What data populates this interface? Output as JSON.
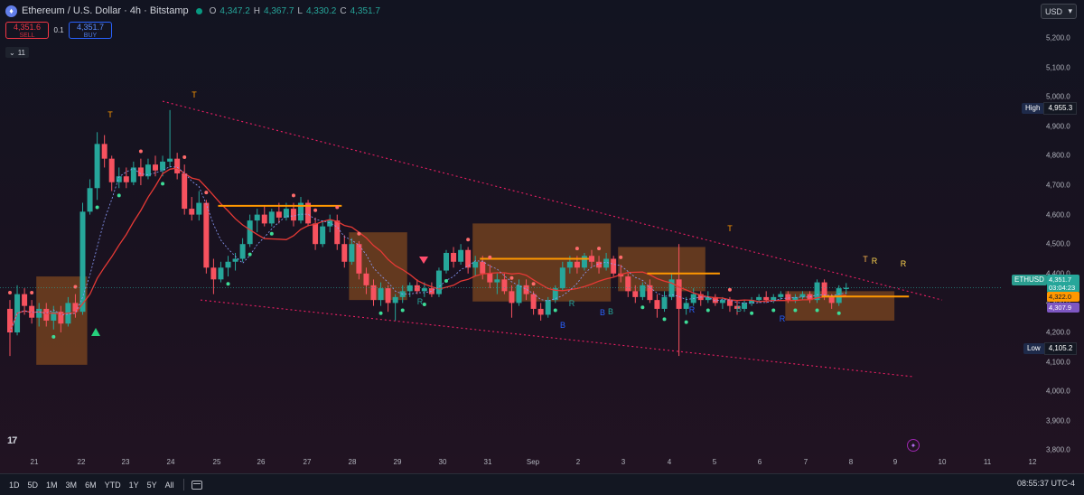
{
  "header": {
    "symbol_icon": "ethereum-icon",
    "title": "Ethereum / U.S. Dollar · 4h · Bitstamp",
    "status_color": "#089981",
    "ohlc": {
      "o_key": "O",
      "o": "4,347.2",
      "h_key": "H",
      "h": "4,367.7",
      "l_key": "L",
      "l": "4,330.2",
      "c_key": "C",
      "c": "4,351.7"
    }
  },
  "trade": {
    "sell_price": "4,351.6",
    "sell_label": "SELL",
    "qty": "0.1",
    "buy_price": "4,351.7",
    "buy_label": "BUY"
  },
  "indicators": {
    "count": "11"
  },
  "currency": {
    "label": "USD"
  },
  "price_axis": {
    "ticks": [
      "5,200.0",
      "5,100.0",
      "5,000.0",
      "4,900.0",
      "4,800.0",
      "4,700.0",
      "4,600.0",
      "4,500.0",
      "4,400.0",
      "4,300.0",
      "4,200.0",
      "4,100.0",
      "4,000.0",
      "3,900.0",
      "3,800.0"
    ],
    "high_label": "High",
    "high_value": "4,955.3",
    "low_label": "Low",
    "low_value": "4,105.2",
    "symbol_tag": "ETHUSD",
    "last_price": "4,351.7",
    "countdown": "03:04:23",
    "tag_orange": "4,322.0",
    "tag_purple": "4,307.9"
  },
  "time_axis": {
    "labels": [
      "21",
      "22",
      "23",
      "24",
      "25",
      "26",
      "27",
      "28",
      "29",
      "30",
      "31",
      "Sep",
      "2",
      "3",
      "4",
      "5",
      "6",
      "7",
      "8",
      "9",
      "10",
      "11",
      "12"
    ]
  },
  "ranges": [
    "1D",
    "5D",
    "1M",
    "3M",
    "6M",
    "YTD",
    "1Y",
    "5Y",
    "All"
  ],
  "clock": "08:55:37 UTC-4",
  "logo_text": "17",
  "chart_marks": [
    "T",
    "T",
    "T",
    "T",
    "R",
    "R",
    "R",
    "R",
    "R",
    "B",
    "B",
    "B",
    "B",
    "R",
    "R"
  ],
  "colors": {
    "up": "#26a69a",
    "down": "#f7525f",
    "zone": "#a0591f",
    "trend": "#e91e63",
    "ema_red": "#e53935",
    "ema_green": "#2e7d32",
    "orange": "#ff9800",
    "purple": "#7e57c2",
    "blue": "#2962ff"
  },
  "chart_data": {
    "type": "candlestick",
    "x_unit": "date (4h candles)",
    "y_range": [
      3760,
      5260
    ],
    "candles": [
      {
        "t": "Aug 20 20:00",
        "o": 4280,
        "h": 4310,
        "l": 4120,
        "c": 4200
      },
      {
        "t": "Aug 21 00:00",
        "o": 4200,
        "h": 4360,
        "l": 4190,
        "c": 4330
      },
      {
        "t": "Aug 21 04:00",
        "o": 4330,
        "h": 4350,
        "l": 4260,
        "c": 4290
      },
      {
        "t": "Aug 21 08:00",
        "o": 4290,
        "h": 4310,
        "l": 4230,
        "c": 4250
      },
      {
        "t": "Aug 21 12:00",
        "o": 4250,
        "h": 4300,
        "l": 4220,
        "c": 4280
      },
      {
        "t": "Aug 21 16:00",
        "o": 4280,
        "h": 4300,
        "l": 4220,
        "c": 4240
      },
      {
        "t": "Aug 21 20:00",
        "o": 4240,
        "h": 4290,
        "l": 4210,
        "c": 4270
      },
      {
        "t": "Aug 22 00:00",
        "o": 4270,
        "h": 4290,
        "l": 4200,
        "c": 4230
      },
      {
        "t": "Aug 22 04:00",
        "o": 4230,
        "h": 4320,
        "l": 4220,
        "c": 4300
      },
      {
        "t": "Aug 22 08:00",
        "o": 4300,
        "h": 4330,
        "l": 4250,
        "c": 4270
      },
      {
        "t": "Aug 22 12:00",
        "o": 4270,
        "h": 4640,
        "l": 4260,
        "c": 4610
      },
      {
        "t": "Aug 22 16:00",
        "o": 4610,
        "h": 4720,
        "l": 4600,
        "c": 4690
      },
      {
        "t": "Aug 22 20:00",
        "o": 4690,
        "h": 4880,
        "l": 4650,
        "c": 4840
      },
      {
        "t": "Aug 23 00:00",
        "o": 4840,
        "h": 4870,
        "l": 4760,
        "c": 4790
      },
      {
        "t": "Aug 23 04:00",
        "o": 4790,
        "h": 4800,
        "l": 4680,
        "c": 4710
      },
      {
        "t": "Aug 23 08:00",
        "o": 4710,
        "h": 4760,
        "l": 4690,
        "c": 4730
      },
      {
        "t": "Aug 23 12:00",
        "o": 4730,
        "h": 4760,
        "l": 4690,
        "c": 4710
      },
      {
        "t": "Aug 23 16:00",
        "o": 4710,
        "h": 4780,
        "l": 4700,
        "c": 4760
      },
      {
        "t": "Aug 23 20:00",
        "o": 4760,
        "h": 4790,
        "l": 4700,
        "c": 4730
      },
      {
        "t": "Aug 24 00:00",
        "o": 4730,
        "h": 4790,
        "l": 4720,
        "c": 4770
      },
      {
        "t": "Aug 24 04:00",
        "o": 4770,
        "h": 4800,
        "l": 4730,
        "c": 4750
      },
      {
        "t": "Aug 24 08:00",
        "o": 4750,
        "h": 4800,
        "l": 4730,
        "c": 4780
      },
      {
        "t": "Aug 24 12:00",
        "o": 4780,
        "h": 4955,
        "l": 4760,
        "c": 4790
      },
      {
        "t": "Aug 24 16:00",
        "o": 4790,
        "h": 4810,
        "l": 4720,
        "c": 4740
      },
      {
        "t": "Aug 24 20:00",
        "o": 4740,
        "h": 4770,
        "l": 4600,
        "c": 4620
      },
      {
        "t": "Aug 25 00:00",
        "o": 4620,
        "h": 4660,
        "l": 4580,
        "c": 4600
      },
      {
        "t": "Aug 25 04:00",
        "o": 4600,
        "h": 4680,
        "l": 4580,
        "c": 4640
      },
      {
        "t": "Aug 25 08:00",
        "o": 4640,
        "h": 4650,
        "l": 4400,
        "c": 4420
      },
      {
        "t": "Aug 25 12:00",
        "o": 4420,
        "h": 4450,
        "l": 4330,
        "c": 4380
      },
      {
        "t": "Aug 25 16:00",
        "o": 4380,
        "h": 4440,
        "l": 4370,
        "c": 4420
      },
      {
        "t": "Aug 25 20:00",
        "o": 4420,
        "h": 4460,
        "l": 4390,
        "c": 4440
      },
      {
        "t": "Aug 26 00:00",
        "o": 4440,
        "h": 4470,
        "l": 4410,
        "c": 4450
      },
      {
        "t": "Aug 26 04:00",
        "o": 4450,
        "h": 4520,
        "l": 4440,
        "c": 4500
      },
      {
        "t": "Aug 26 08:00",
        "o": 4500,
        "h": 4600,
        "l": 4490,
        "c": 4580
      },
      {
        "t": "Aug 26 12:00",
        "o": 4580,
        "h": 4620,
        "l": 4540,
        "c": 4600
      },
      {
        "t": "Aug 26 16:00",
        "o": 4600,
        "h": 4630,
        "l": 4560,
        "c": 4570
      },
      {
        "t": "Aug 26 20:00",
        "o": 4570,
        "h": 4620,
        "l": 4560,
        "c": 4610
      },
      {
        "t": "Aug 27 00:00",
        "o": 4610,
        "h": 4640,
        "l": 4570,
        "c": 4590
      },
      {
        "t": "Aug 27 04:00",
        "o": 4590,
        "h": 4640,
        "l": 4580,
        "c": 4620
      },
      {
        "t": "Aug 27 08:00",
        "o": 4620,
        "h": 4640,
        "l": 4560,
        "c": 4580
      },
      {
        "t": "Aug 27 12:00",
        "o": 4580,
        "h": 4660,
        "l": 4570,
        "c": 4640
      },
      {
        "t": "Aug 27 16:00",
        "o": 4640,
        "h": 4650,
        "l": 4560,
        "c": 4570
      },
      {
        "t": "Aug 27 20:00",
        "o": 4570,
        "h": 4590,
        "l": 4480,
        "c": 4500
      },
      {
        "t": "Aug 28 00:00",
        "o": 4500,
        "h": 4580,
        "l": 4490,
        "c": 4560
      },
      {
        "t": "Aug 28 04:00",
        "o": 4560,
        "h": 4600,
        "l": 4540,
        "c": 4580
      },
      {
        "t": "Aug 28 08:00",
        "o": 4580,
        "h": 4600,
        "l": 4480,
        "c": 4500
      },
      {
        "t": "Aug 28 12:00",
        "o": 4500,
        "h": 4530,
        "l": 4420,
        "c": 4440
      },
      {
        "t": "Aug 28 16:00",
        "o": 4440,
        "h": 4520,
        "l": 4430,
        "c": 4500
      },
      {
        "t": "Aug 28 20:00",
        "o": 4500,
        "h": 4510,
        "l": 4380,
        "c": 4400
      },
      {
        "t": "Aug 29 00:00",
        "o": 4400,
        "h": 4420,
        "l": 4330,
        "c": 4360
      },
      {
        "t": "Aug 29 04:00",
        "o": 4360,
        "h": 4380,
        "l": 4290,
        "c": 4310
      },
      {
        "t": "Aug 29 08:00",
        "o": 4310,
        "h": 4370,
        "l": 4290,
        "c": 4350
      },
      {
        "t": "Aug 29 12:00",
        "o": 4350,
        "h": 4360,
        "l": 4270,
        "c": 4300
      },
      {
        "t": "Aug 29 16:00",
        "o": 4300,
        "h": 4330,
        "l": 4240,
        "c": 4320
      },
      {
        "t": "Aug 29 20:00",
        "o": 4320,
        "h": 4360,
        "l": 4300,
        "c": 4340
      },
      {
        "t": "Aug 30 00:00",
        "o": 4340,
        "h": 4370,
        "l": 4320,
        "c": 4360
      },
      {
        "t": "Aug 30 04:00",
        "o": 4360,
        "h": 4380,
        "l": 4330,
        "c": 4340
      },
      {
        "t": "Aug 30 08:00",
        "o": 4340,
        "h": 4370,
        "l": 4320,
        "c": 4350
      },
      {
        "t": "Aug 30 12:00",
        "o": 4350,
        "h": 4370,
        "l": 4320,
        "c": 4330
      },
      {
        "t": "Aug 30 16:00",
        "o": 4330,
        "h": 4420,
        "l": 4320,
        "c": 4410
      },
      {
        "t": "Aug 30 20:00",
        "o": 4410,
        "h": 4480,
        "l": 4400,
        "c": 4470
      },
      {
        "t": "Aug 31 00:00",
        "o": 4470,
        "h": 4490,
        "l": 4420,
        "c": 4440
      },
      {
        "t": "Aug 31 04:00",
        "o": 4440,
        "h": 4500,
        "l": 4430,
        "c": 4480
      },
      {
        "t": "Aug 31 08:00",
        "o": 4480,
        "h": 4490,
        "l": 4400,
        "c": 4420
      },
      {
        "t": "Aug 31 12:00",
        "o": 4420,
        "h": 4460,
        "l": 4390,
        "c": 4440
      },
      {
        "t": "Aug 31 16:00",
        "o": 4440,
        "h": 4460,
        "l": 4380,
        "c": 4400
      },
      {
        "t": "Aug 31 20:00",
        "o": 4400,
        "h": 4430,
        "l": 4350,
        "c": 4370
      },
      {
        "t": "Sep 1 00:00",
        "o": 4370,
        "h": 4400,
        "l": 4330,
        "c": 4380
      },
      {
        "t": "Sep 1 04:00",
        "o": 4380,
        "h": 4400,
        "l": 4330,
        "c": 4340
      },
      {
        "t": "Sep 1 08:00",
        "o": 4340,
        "h": 4360,
        "l": 4250,
        "c": 4300
      },
      {
        "t": "Sep 1 12:00",
        "o": 4300,
        "h": 4380,
        "l": 4290,
        "c": 4360
      },
      {
        "t": "Sep 1 16:00",
        "o": 4360,
        "h": 4380,
        "l": 4310,
        "c": 4330
      },
      {
        "t": "Sep 1 20:00",
        "o": 4330,
        "h": 4340,
        "l": 4260,
        "c": 4280
      },
      {
        "t": "Sep 2 00:00",
        "o": 4280,
        "h": 4300,
        "l": 4240,
        "c": 4260
      },
      {
        "t": "Sep 2 04:00",
        "o": 4260,
        "h": 4320,
        "l": 4250,
        "c": 4310
      },
      {
        "t": "Sep 2 08:00",
        "o": 4310,
        "h": 4360,
        "l": 4300,
        "c": 4350
      },
      {
        "t": "Sep 2 12:00",
        "o": 4350,
        "h": 4440,
        "l": 4340,
        "c": 4420
      },
      {
        "t": "Sep 2 16:00",
        "o": 4420,
        "h": 4460,
        "l": 4400,
        "c": 4440
      },
      {
        "t": "Sep 2 20:00",
        "o": 4440,
        "h": 4460,
        "l": 4400,
        "c": 4420
      },
      {
        "t": "Sep 3 00:00",
        "o": 4420,
        "h": 4470,
        "l": 4410,
        "c": 4460
      },
      {
        "t": "Sep 3 04:00",
        "o": 4460,
        "h": 4480,
        "l": 4420,
        "c": 4440
      },
      {
        "t": "Sep 3 08:00",
        "o": 4440,
        "h": 4460,
        "l": 4400,
        "c": 4420
      },
      {
        "t": "Sep 3 12:00",
        "o": 4420,
        "h": 4470,
        "l": 4410,
        "c": 4450
      },
      {
        "t": "Sep 3 16:00",
        "o": 4450,
        "h": 4460,
        "l": 4390,
        "c": 4400
      },
      {
        "t": "Sep 3 20:00",
        "o": 4400,
        "h": 4430,
        "l": 4370,
        "c": 4390
      },
      {
        "t": "Sep 4 00:00",
        "o": 4390,
        "h": 4400,
        "l": 4320,
        "c": 4340
      },
      {
        "t": "Sep 4 04:00",
        "o": 4340,
        "h": 4360,
        "l": 4300,
        "c": 4320
      },
      {
        "t": "Sep 4 08:00",
        "o": 4320,
        "h": 4370,
        "l": 4310,
        "c": 4360
      },
      {
        "t": "Sep 4 12:00",
        "o": 4360,
        "h": 4380,
        "l": 4300,
        "c": 4310
      },
      {
        "t": "Sep 4 16:00",
        "o": 4310,
        "h": 4330,
        "l": 4250,
        "c": 4280
      },
      {
        "t": "Sep 4 20:00",
        "o": 4280,
        "h": 4340,
        "l": 4270,
        "c": 4320
      },
      {
        "t": "Sep 5 00:00",
        "o": 4320,
        "h": 4400,
        "l": 4310,
        "c": 4380
      },
      {
        "t": "Sep 5 04:00",
        "o": 4380,
        "h": 4500,
        "l": 4120,
        "c": 4280
      },
      {
        "t": "Sep 5 08:00",
        "o": 4280,
        "h": 4320,
        "l": 4260,
        "c": 4300
      },
      {
        "t": "Sep 5 12:00",
        "o": 4300,
        "h": 4350,
        "l": 4290,
        "c": 4330
      },
      {
        "t": "Sep 5 16:00",
        "o": 4330,
        "h": 4340,
        "l": 4290,
        "c": 4310
      },
      {
        "t": "Sep 5 20:00",
        "o": 4310,
        "h": 4340,
        "l": 4300,
        "c": 4320
      },
      {
        "t": "Sep 6 00:00",
        "o": 4320,
        "h": 4330,
        "l": 4290,
        "c": 4300
      },
      {
        "t": "Sep 6 04:00",
        "o": 4300,
        "h": 4320,
        "l": 4280,
        "c": 4310
      },
      {
        "t": "Sep 6 08:00",
        "o": 4310,
        "h": 4320,
        "l": 4270,
        "c": 4290
      },
      {
        "t": "Sep 6 12:00",
        "o": 4290,
        "h": 4310,
        "l": 4260,
        "c": 4280
      },
      {
        "t": "Sep 6 16:00",
        "o": 4280,
        "h": 4310,
        "l": 4270,
        "c": 4300
      },
      {
        "t": "Sep 6 20:00",
        "o": 4300,
        "h": 4320,
        "l": 4290,
        "c": 4310
      },
      {
        "t": "Sep 7 00:00",
        "o": 4310,
        "h": 4330,
        "l": 4300,
        "c": 4320
      },
      {
        "t": "Sep 7 04:00",
        "o": 4320,
        "h": 4340,
        "l": 4300,
        "c": 4310
      },
      {
        "t": "Sep 7 08:00",
        "o": 4310,
        "h": 4330,
        "l": 4300,
        "c": 4320
      },
      {
        "t": "Sep 7 12:00",
        "o": 4320,
        "h": 4340,
        "l": 4310,
        "c": 4330
      },
      {
        "t": "Sep 7 16:00",
        "o": 4330,
        "h": 4340,
        "l": 4300,
        "c": 4310
      },
      {
        "t": "Sep 7 20:00",
        "o": 4310,
        "h": 4330,
        "l": 4300,
        "c": 4320
      },
      {
        "t": "Sep 8 00:00",
        "o": 4320,
        "h": 4340,
        "l": 4310,
        "c": 4330
      },
      {
        "t": "Sep 8 04:00",
        "o": 4330,
        "h": 4340,
        "l": 4300,
        "c": 4310
      },
      {
        "t": "Sep 8 08:00",
        "o": 4310,
        "h": 4380,
        "l": 4300,
        "c": 4370
      },
      {
        "t": "Sep 8 12:00",
        "o": 4370,
        "h": 4380,
        "l": 4310,
        "c": 4320
      },
      {
        "t": "Sep 8 16:00",
        "o": 4320,
        "h": 4330,
        "l": 4280,
        "c": 4300
      },
      {
        "t": "Sep 8 20:00",
        "o": 4300,
        "h": 4360,
        "l": 4290,
        "c": 4350
      },
      {
        "t": "Sep 9 00:00",
        "o": 4347.2,
        "h": 4367.7,
        "l": 4330.2,
        "c": 4351.7
      }
    ],
    "trendline_upper": {
      "from": [
        "Aug 24",
        "4985"
      ],
      "to": [
        "Sep 9",
        "4310"
      ]
    },
    "trendline_lower": {
      "from": [
        "Aug 25",
        "4310"
      ],
      "to": [
        "Sep 9",
        "4050"
      ]
    },
    "high": 4955.3,
    "low": 4105.2,
    "last": 4351.7
  }
}
